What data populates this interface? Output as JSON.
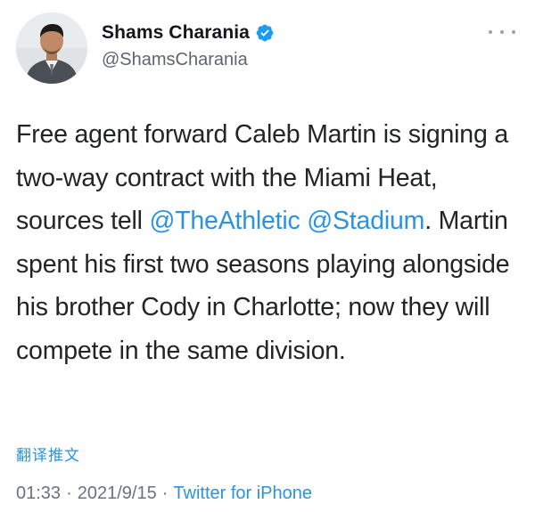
{
  "author": {
    "display_name": "Shams Charania",
    "handle": "@ShamsCharania",
    "verified": true,
    "avatar_icon": "profile-photo"
  },
  "tweet": {
    "text_1": "Free agent forward Caleb Martin is signing a two-way contract with the Miami Heat, sources tell ",
    "mention_1": "@TheAthletic",
    "text_2": " ",
    "mention_2": "@Stadium",
    "text_3": ". Martin spent his first two seasons playing alongside his brother Cody in Charlotte; now they will compete in the same division."
  },
  "translate_label": "翻译推文",
  "meta": {
    "time": "01:33",
    "separator": "·",
    "date": "2021/9/15",
    "source": "Twitter for iPhone"
  },
  "colors": {
    "link": "#2b93de",
    "verified": "#1d9bf0",
    "secondary_text": "#69737d"
  }
}
